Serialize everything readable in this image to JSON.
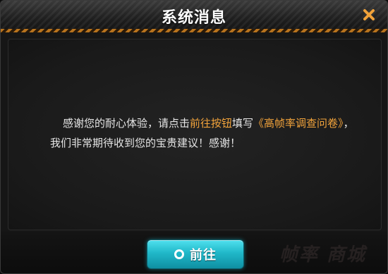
{
  "dialog": {
    "title": "系统消息",
    "close_icon": "close-icon",
    "message": {
      "part1": "感谢您的耐心体验，请点击",
      "link_button": "前往按钮",
      "part2": "填写",
      "survey_name": "《高帧率调查问卷》",
      "part3": "，我们非常期待收到您的宝贵建议！感谢！"
    },
    "confirm_button": {
      "label": "前往",
      "icon": "circle-icon"
    },
    "background_text": [
      "帧率",
      "商城"
    ]
  },
  "colors": {
    "accent_orange": "#f2a33b",
    "button_cyan": "#20b8c9",
    "title_stripe": "#b8731e"
  }
}
